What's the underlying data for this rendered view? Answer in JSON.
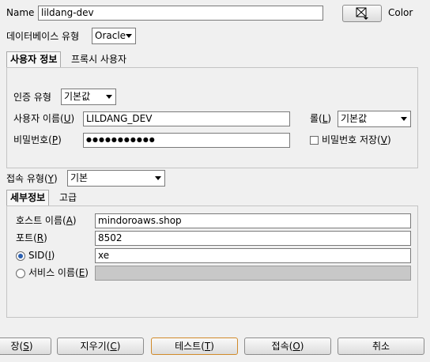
{
  "top": {
    "name_label": "Name",
    "name_value": "lildang-dev",
    "color_label": "Color",
    "color_icon": "color-picker-icon",
    "db_type_label": "데이터베이스 유형",
    "db_type_value": "Oracle"
  },
  "tabs_top": [
    {
      "label": "사용자 정보",
      "active": true
    },
    {
      "label": "프록시 사용자",
      "active": false
    }
  ],
  "auth": {
    "auth_type_label": "인증 유형",
    "auth_type_value": "기본값",
    "username_label": "사용자 이름(",
    "username_mnemonic": "U",
    "username_suffix": ")",
    "username_value": "LILDANG_DEV",
    "role_label": "롤(",
    "role_mnemonic": "L",
    "role_suffix": ")",
    "role_value": "기본값",
    "password_label": "비밀번호(",
    "password_mnemonic": "P",
    "password_suffix": ")",
    "password_value": "●●●●●●●●●●●",
    "save_password_label": "비밀번호 저장(",
    "save_password_mnemonic": "V",
    "save_password_suffix": ")",
    "save_password_checked": false
  },
  "connection": {
    "conn_type_label": "접속 유형(",
    "conn_type_mnemonic": "Y",
    "conn_type_suffix": ")",
    "conn_type_value": "기본"
  },
  "tabs_bottom": [
    {
      "label": "세부정보",
      "active": true
    },
    {
      "label": "고급",
      "active": false
    }
  ],
  "details": {
    "host_label": "호스트 이름(",
    "host_mnemonic": "A",
    "host_suffix": ")",
    "host_value": "mindoroaws.shop",
    "port_label": "포트(",
    "port_mnemonic": "R",
    "port_suffix": ")",
    "port_value": "8502",
    "sid_label": "SID(",
    "sid_mnemonic": "I",
    "sid_suffix": ")",
    "sid_value": "xe",
    "sid_selected": true,
    "service_label": "서비스 이름(",
    "service_mnemonic": "E",
    "service_suffix": ")",
    "service_value": ""
  },
  "buttons": {
    "save_partial": "장(",
    "save_mnemonic": "S",
    "save_suffix": ")",
    "clear_label": "지우기(",
    "clear_mnemonic": "C",
    "clear_suffix": ")",
    "test_label": "테스트(",
    "test_mnemonic": "T",
    "test_suffix": ")",
    "connect_label": "접속(",
    "connect_mnemonic": "O",
    "connect_suffix": ")",
    "cancel_label": "취소"
  }
}
